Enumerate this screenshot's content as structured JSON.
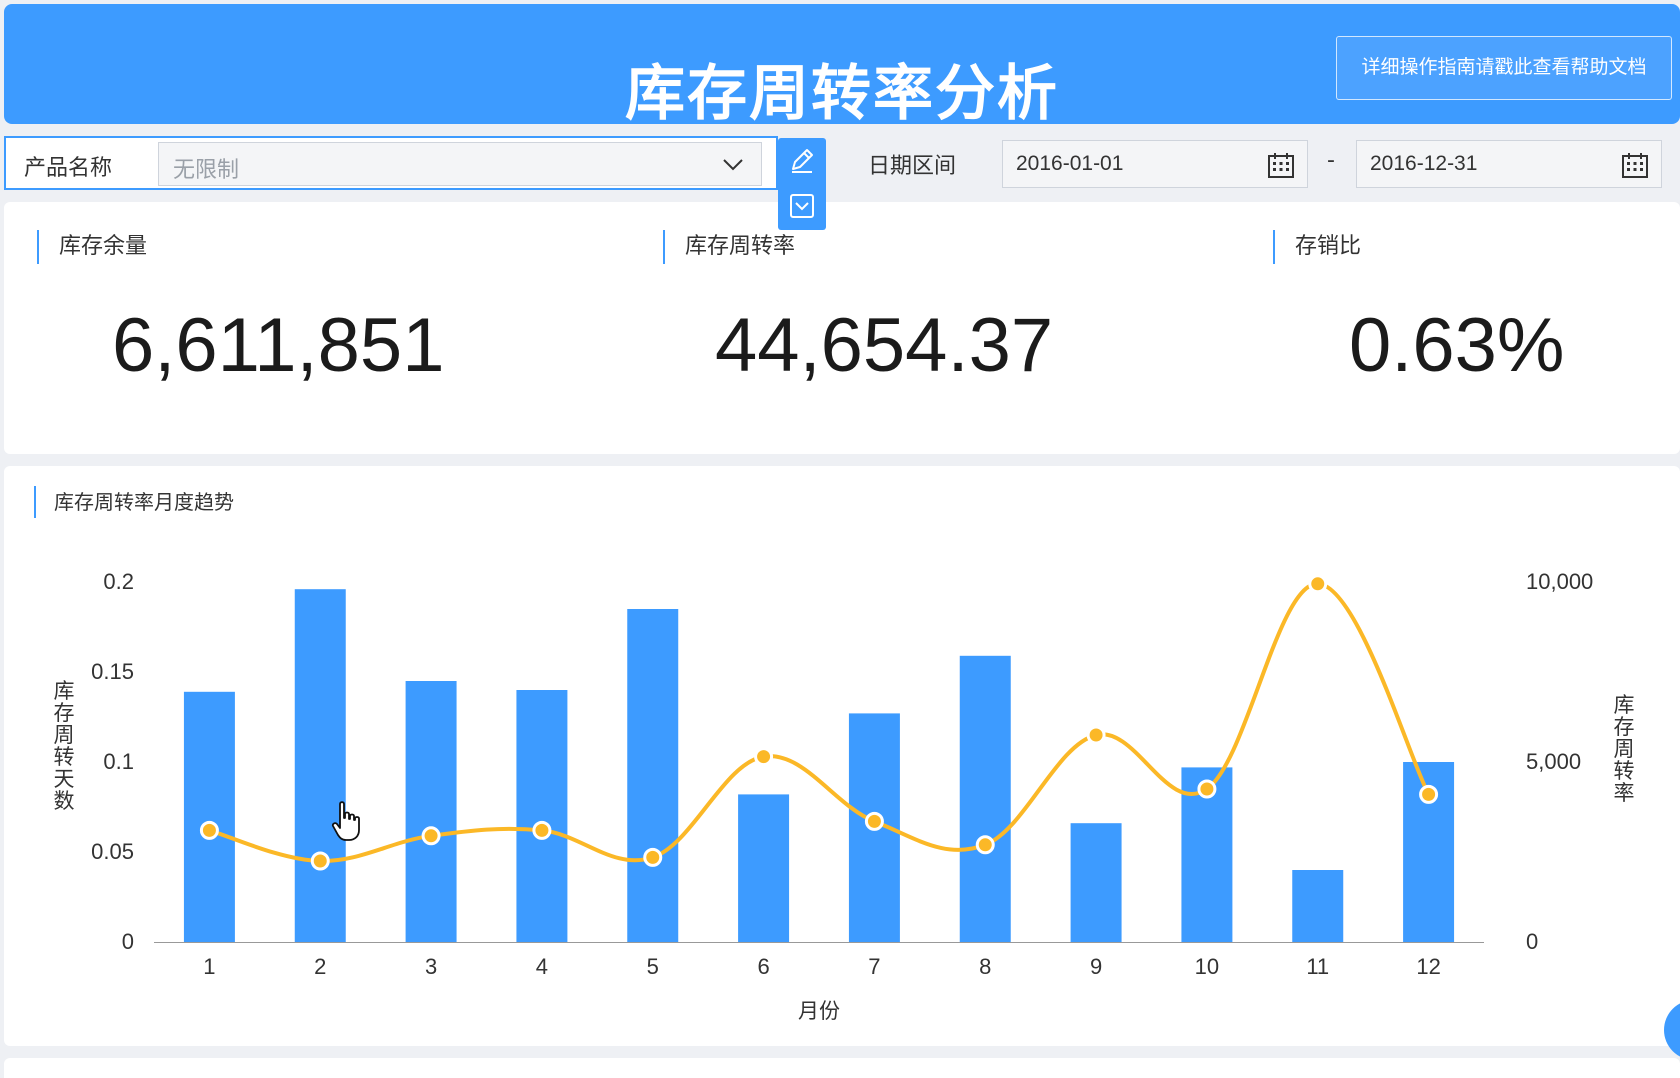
{
  "header": {
    "title": "库存周转率分析",
    "help_label": "详细操作指南请戳此查看帮助文档"
  },
  "filters": {
    "product_label": "产品名称",
    "product_value": "无限制",
    "date_label": "日期区间",
    "date_start": "2016-01-01",
    "date_separator": "-",
    "date_end": "2016-12-31"
  },
  "kpis": [
    {
      "label": "库存余量",
      "value": "6,611,851"
    },
    {
      "label": "库存周转率",
      "value": "44,654.37"
    },
    {
      "label": "存销比",
      "value": "0.63%"
    }
  ],
  "colors": {
    "accent": "#3d9bff",
    "bar": "#3d9bff",
    "line": "#fbb827"
  },
  "chart_data": {
    "type": "bar",
    "title": "库存周转率月度趋势",
    "xlabel": "月份",
    "categories": [
      "1",
      "2",
      "3",
      "4",
      "5",
      "6",
      "7",
      "8",
      "9",
      "10",
      "11",
      "12"
    ],
    "y_left": {
      "label": "库存周转天数",
      "lim": [
        0,
        0.2
      ],
      "ticks": [
        "0",
        "0.05",
        "0.1",
        "0.15",
        "0.2"
      ],
      "tick_values": [
        0,
        0.05,
        0.1,
        0.15,
        0.2
      ]
    },
    "y_right": {
      "label": "库存周转率",
      "lim": [
        0,
        10000
      ],
      "ticks": [
        "0",
        "5,000",
        "10,000"
      ],
      "tick_values": [
        0,
        5000,
        10000
      ]
    },
    "series": [
      {
        "type": "bar",
        "axis": "left",
        "values": [
          0.139,
          0.196,
          0.145,
          0.14,
          0.185,
          0.082,
          0.127,
          0.159,
          0.066,
          0.097,
          0.04,
          0.1
        ]
      },
      {
        "type": "line",
        "axis": "right",
        "smooth": true,
        "values": [
          3100,
          2250,
          2950,
          3100,
          2350,
          5150,
          3350,
          2700,
          5750,
          4250,
          9950,
          4100
        ]
      }
    ],
    "grid": false,
    "legend": "none"
  }
}
